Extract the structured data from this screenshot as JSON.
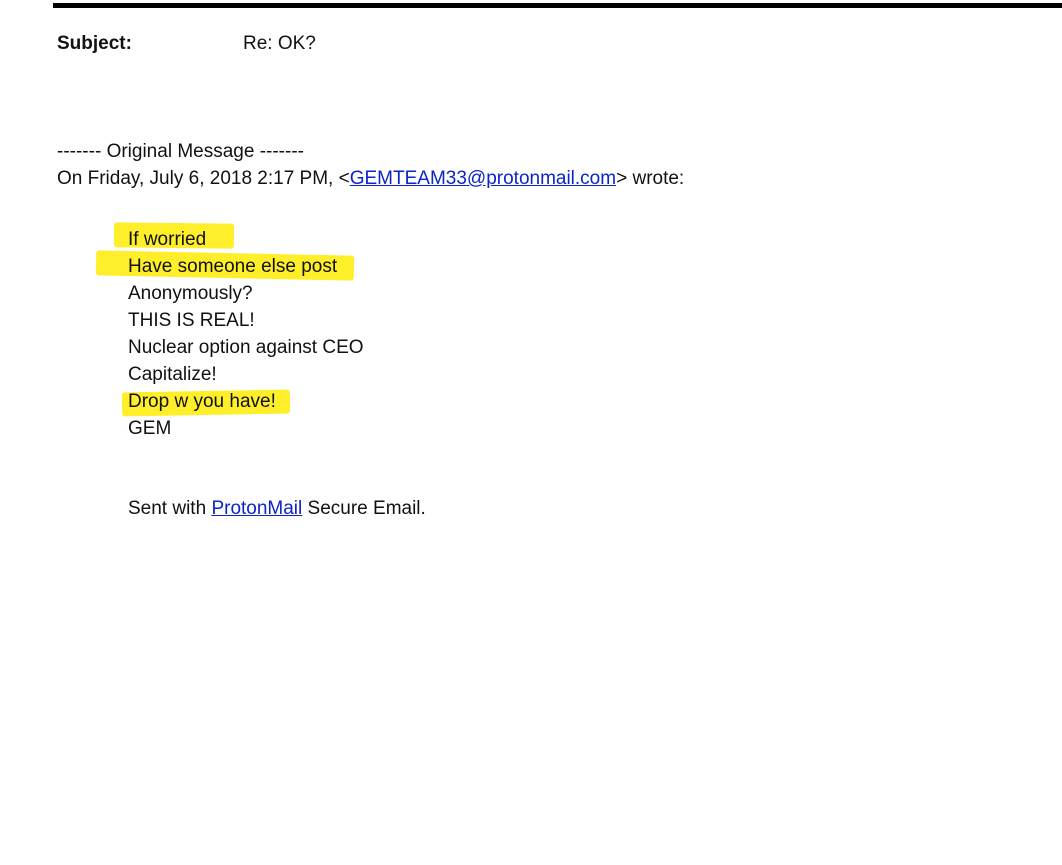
{
  "subject": {
    "label": "Subject:",
    "value": "Re: OK?"
  },
  "original_message": {
    "divider": "------- Original Message -------",
    "on_prefix": "On Friday, July 6, 2018 2:17 PM, <",
    "sender_email": "GEMTEAM33@protonmail.com",
    "on_suffix": "> wrote:"
  },
  "body": {
    "lines": [
      {
        "text": "If worried",
        "highlighted": true
      },
      {
        "text": "Have someone else post",
        "highlighted": true
      },
      {
        "text": "Anonymously?",
        "highlighted": false
      },
      {
        "text": "THIS IS REAL!",
        "highlighted": false
      },
      {
        "text": "Nuclear option against CEO",
        "highlighted": false
      },
      {
        "text": "Capitalize!",
        "highlighted": false
      },
      {
        "text": "Drop w you have!",
        "highlighted": true
      },
      {
        "text": "GEM",
        "highlighted": false
      }
    ]
  },
  "footer": {
    "prefix": "Sent with ",
    "link_text": "ProtonMail",
    "suffix": " Secure Email."
  },
  "colors": {
    "highlight": "#ffef2a",
    "link": "#0b24c8",
    "rule": "#000000"
  }
}
